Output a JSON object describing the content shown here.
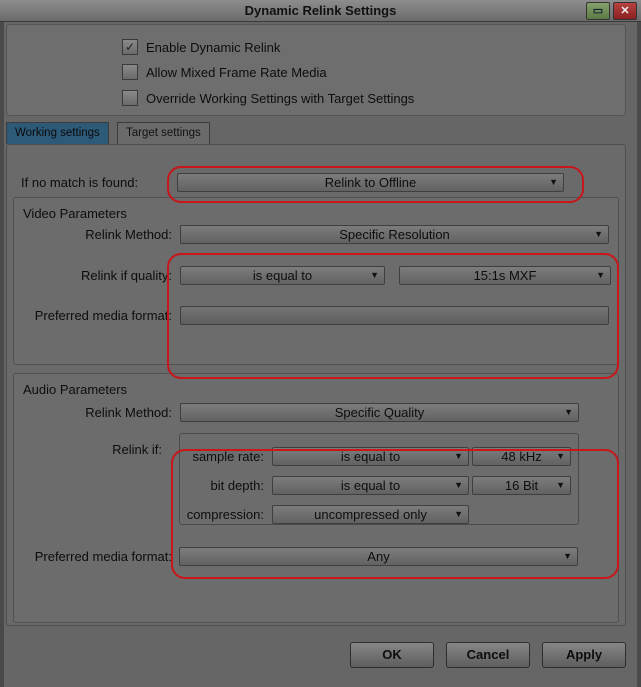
{
  "window": {
    "title": "Dynamic Relink Settings"
  },
  "options": {
    "enable_dynamic_relink": {
      "label": "Enable Dynamic Relink",
      "checked": true
    },
    "allow_mixed": {
      "label": "Allow Mixed Frame Rate Media",
      "checked": false
    },
    "override_working": {
      "label": "Override Working Settings with Target Settings",
      "checked": false
    }
  },
  "tabs": [
    {
      "label": "Working settings",
      "active": true
    },
    {
      "label": "Target settings",
      "active": false
    }
  ],
  "no_match": {
    "label": "If no match is found:",
    "value": "Relink to Offline"
  },
  "video": {
    "title": "Video Parameters",
    "relink_method_label": "Relink Method:",
    "relink_method_value": "Specific Resolution",
    "relink_quality_label": "Relink if quality:",
    "quality_operator": "is equal to",
    "quality_value": "15:1s  MXF",
    "preferred_label": "Preferred media format:",
    "preferred_value": ""
  },
  "audio": {
    "title": "Audio Parameters",
    "relink_method_label": "Relink Method:",
    "relink_method_value": "Specific Quality",
    "relink_if_label": "Relink if:",
    "sample_rate_label": "sample rate:",
    "sample_rate_operator": "is equal to",
    "sample_rate_value": "48 kHz",
    "bit_depth_label": "bit depth:",
    "bit_depth_operator": "is equal to",
    "bit_depth_value": "16 Bit",
    "compression_label": "compression:",
    "compression_value": "uncompressed only"
  },
  "preferred_media": {
    "label": "Preferred media format:",
    "value": "Any"
  },
  "buttons": {
    "ok": "OK",
    "cancel": "Cancel",
    "apply": "Apply"
  },
  "colors": {
    "highlight": "#c8161a",
    "active_tab": "#2e5a7a"
  }
}
